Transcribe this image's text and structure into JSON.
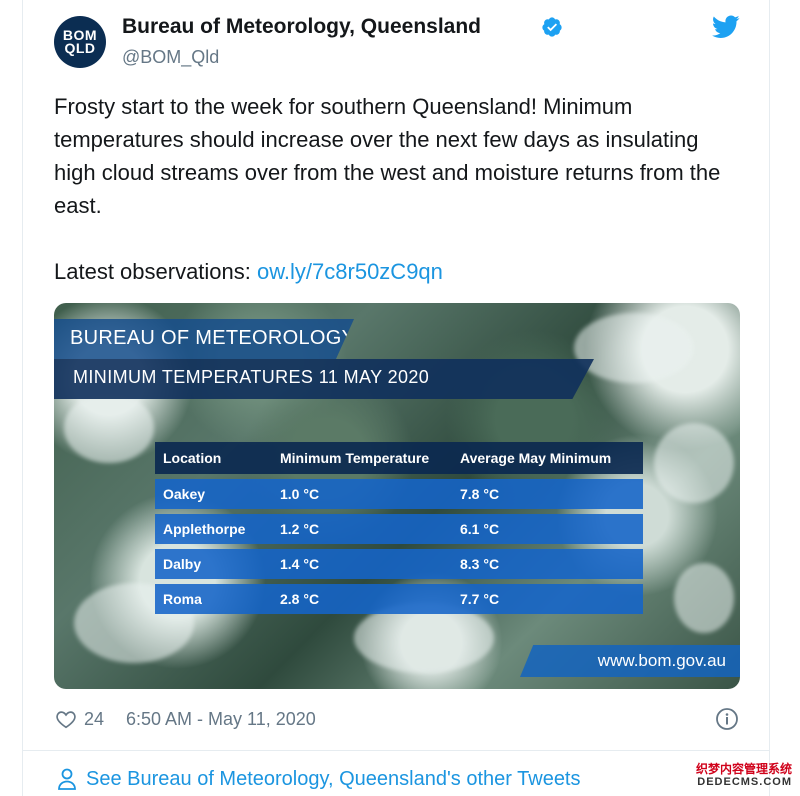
{
  "account": {
    "name": "Bureau of Meteorology, Queensland",
    "handle": "@BOM_Qld",
    "avatar_line1": "BOM",
    "avatar_line2": "QLD",
    "verified_icon": "verified-badge-icon"
  },
  "tweet": {
    "text": "Frosty start to the week for southern Queensland! Minimum temperatures should increase over the next few days as insulating high cloud streams over from the west and moisture returns from the east.",
    "observations_prefix": "Latest observations: ",
    "observations_link": "ow.ly/7c8r50zC9qn"
  },
  "media": {
    "banner_title": "BUREAU OF METEOROLOGY",
    "banner_subtitle": "MINIMUM TEMPERATURES 11 MAY 2020",
    "table": {
      "headers": [
        "Location",
        "Minimum Temperature",
        "Average May Minimum"
      ],
      "rows": [
        [
          "Oakey",
          "1.0 °C",
          "7.8 °C"
        ],
        [
          "Applethorpe",
          "1.2 °C",
          "6.1 °C"
        ],
        [
          "Dalby",
          "1.4 °C",
          "8.3 °C"
        ],
        [
          "Roma",
          "2.8 °C",
          "7.7 °C"
        ]
      ]
    },
    "url": "www.bom.gov.au"
  },
  "footer": {
    "likes": "24",
    "timestamp": "6:50 AM - May 11, 2020",
    "other_tweets": "See Bureau of Meteorology, Queensland's other Tweets"
  },
  "watermark": {
    "line1": "织梦内容管理系统",
    "line2": "DEDECMS.COM"
  },
  "colors": {
    "link": "#1b95e0",
    "twitter_blue": "#1da1f2",
    "text_secondary": "#657786",
    "avatar_bg": "#0b2d52"
  }
}
